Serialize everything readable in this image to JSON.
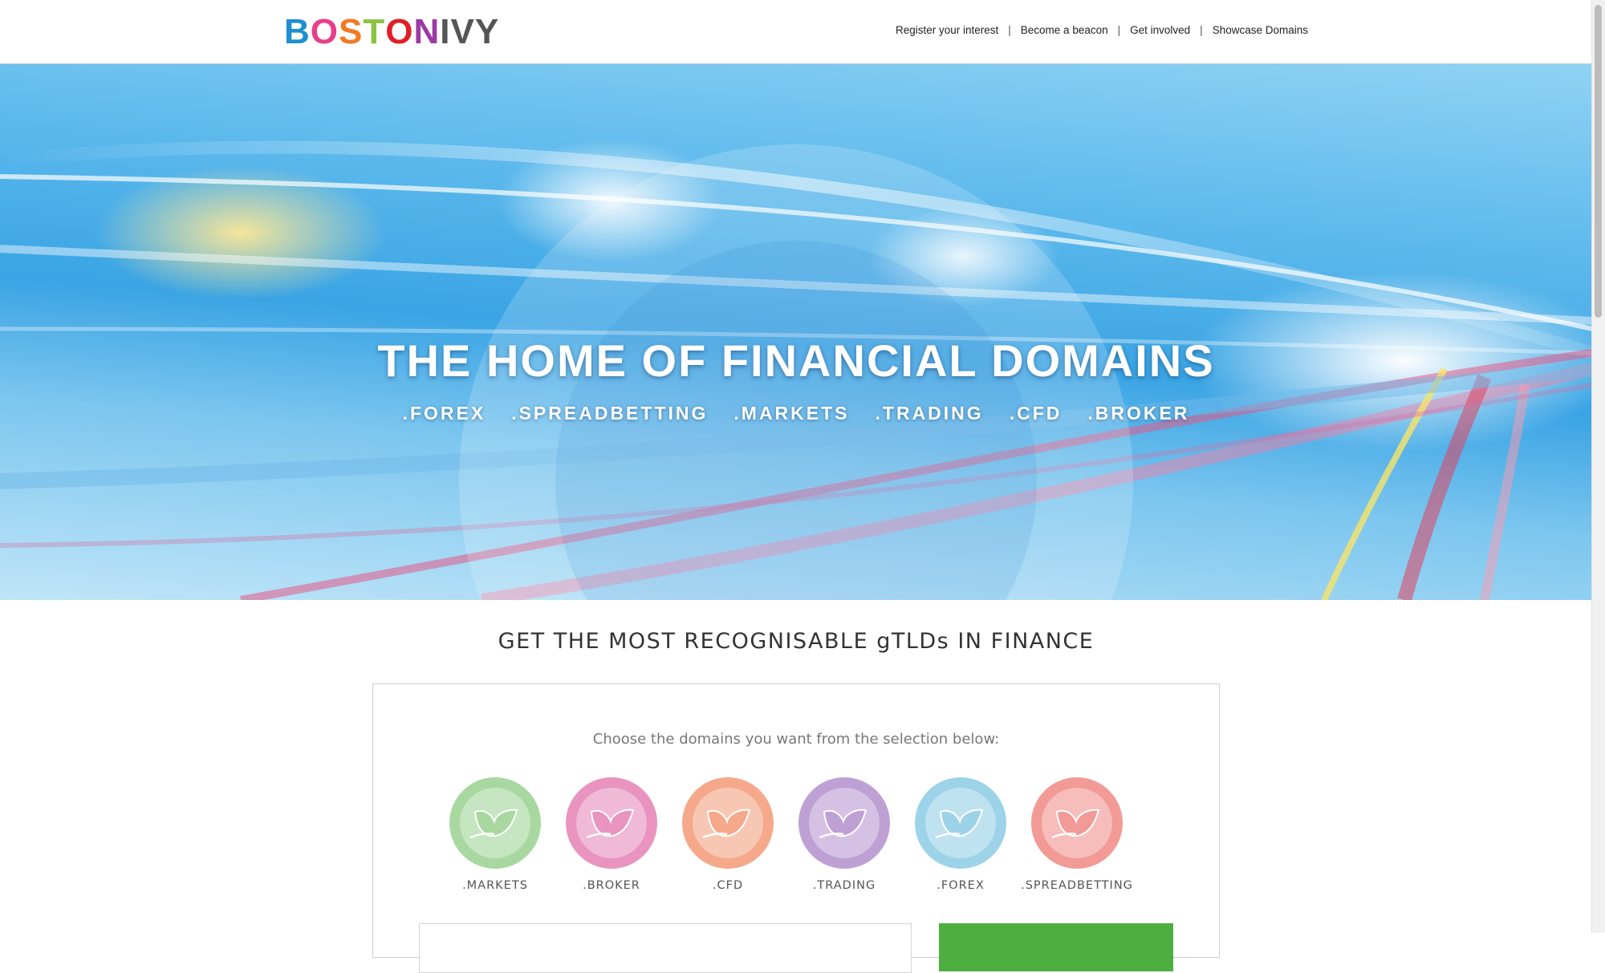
{
  "header": {
    "logo": {
      "letters": [
        {
          "char": "B",
          "color": "#1e8fd0"
        },
        {
          "char": "O",
          "color": "#e83e8c"
        },
        {
          "char": "S",
          "color": "#f27a25"
        },
        {
          "char": "T",
          "color": "#8bc53f"
        },
        {
          "char": "O",
          "color": "#e01f26"
        },
        {
          "char": "N",
          "color": "#9b3aa5"
        },
        {
          "char": "I",
          "color": "#555555"
        },
        {
          "char": "V",
          "color": "#555555"
        },
        {
          "char": "Y",
          "color": "#555555"
        }
      ]
    },
    "nav": [
      {
        "label": "Register your interest"
      },
      {
        "label": "Become a beacon"
      },
      {
        "label": "Get involved"
      },
      {
        "label": "Showcase Domains"
      }
    ],
    "separator": "|"
  },
  "hero": {
    "title": "THE HOME OF FINANCIAL DOMAINS",
    "subtitle_items": [
      ".FOREX",
      ".SPREADBETTING",
      ".MARKETS",
      ".TRADING",
      ".CFD",
      ".BROKER"
    ]
  },
  "section": {
    "title": "GET THE MOST RECOGNISABLE gTLDs IN FINANCE",
    "choose_text": "Choose the domains you want from the selection below:"
  },
  "domains": [
    {
      "label": ".MARKETS",
      "color": "#a8d8a0",
      "inner": "#ffffff"
    },
    {
      "label": ".BROKER",
      "color": "#e894bf",
      "inner": "#ffffff"
    },
    {
      "label": ".CFD",
      "color": "#f5a98a",
      "inner": "#ffffff"
    },
    {
      "label": ".TRADING",
      "color": "#bfa0d4",
      "inner": "#ffffff"
    },
    {
      "label": ".FOREX",
      "color": "#9dd3e8",
      "inner": "#ffffff"
    },
    {
      "label": ".SPREADBETTING",
      "color": "#f29a96",
      "inner": "#ffffff"
    }
  ],
  "colors": {
    "go_button": "#4caf3f"
  },
  "icons": {
    "domain_icon": "ivy-leaf-icon"
  }
}
